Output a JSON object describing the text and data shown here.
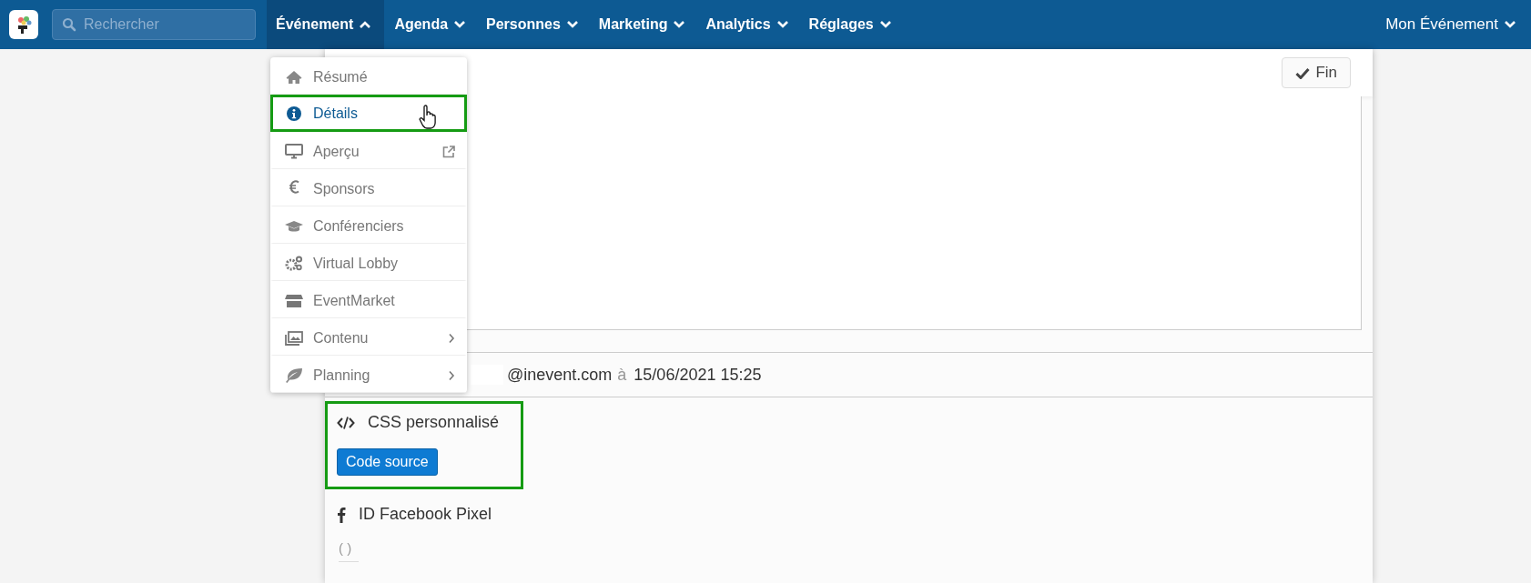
{
  "nav": {
    "search": {
      "placeholder": "Rechercher"
    },
    "items": [
      {
        "label": "Événement",
        "selected": true,
        "expanded": true
      },
      {
        "label": "Agenda",
        "selected": false,
        "expanded": false
      },
      {
        "label": "Personnes",
        "selected": false,
        "expanded": false
      },
      {
        "label": "Marketing",
        "selected": false,
        "expanded": false
      },
      {
        "label": "Analytics",
        "selected": false,
        "expanded": false
      },
      {
        "label": "Réglages",
        "selected": false,
        "expanded": false
      }
    ],
    "account": {
      "label": "Mon Événement",
      "expanded": false
    }
  },
  "dropdown": {
    "items": [
      {
        "label": "Résumé",
        "kind": "home",
        "selected": false,
        "highlighted": false,
        "submenu": false,
        "external": false
      },
      {
        "label": "Détails",
        "kind": "info",
        "selected": true,
        "highlighted": true,
        "submenu": false,
        "external": false
      },
      {
        "label": "Aperçu",
        "kind": "monitor",
        "selected": false,
        "highlighted": false,
        "submenu": false,
        "external": true
      },
      {
        "label": "Sponsors",
        "kind": "euro",
        "selected": false,
        "highlighted": false,
        "submenu": false,
        "external": false
      },
      {
        "label": "Conférenciers",
        "kind": "cap",
        "selected": false,
        "highlighted": false,
        "submenu": false,
        "external": false
      },
      {
        "label": "Virtual Lobby",
        "kind": "gears",
        "selected": false,
        "highlighted": false,
        "submenu": false,
        "external": false
      },
      {
        "label": "EventMarket",
        "kind": "store",
        "selected": false,
        "highlighted": false,
        "submenu": false,
        "external": false
      },
      {
        "label": "Contenu",
        "kind": "images",
        "selected": false,
        "highlighted": false,
        "submenu": true,
        "external": false
      },
      {
        "label": "Planning",
        "kind": "leaf",
        "selected": false,
        "highlighted": false,
        "submenu": true,
        "external": false
      }
    ]
  },
  "toolbar": {
    "done_button": "Fin"
  },
  "audit": {
    "email": "@inevent.com",
    "connector": "à",
    "timestamp": "15/06/2021 15:25"
  },
  "sections": [
    {
      "kind": "css",
      "title": "CSS personnalisé",
      "button": "Code source",
      "highlighted": true
    },
    {
      "kind": "facebook",
      "title": "ID Facebook Pixel",
      "value": "( )",
      "highlighted": false
    }
  ]
}
